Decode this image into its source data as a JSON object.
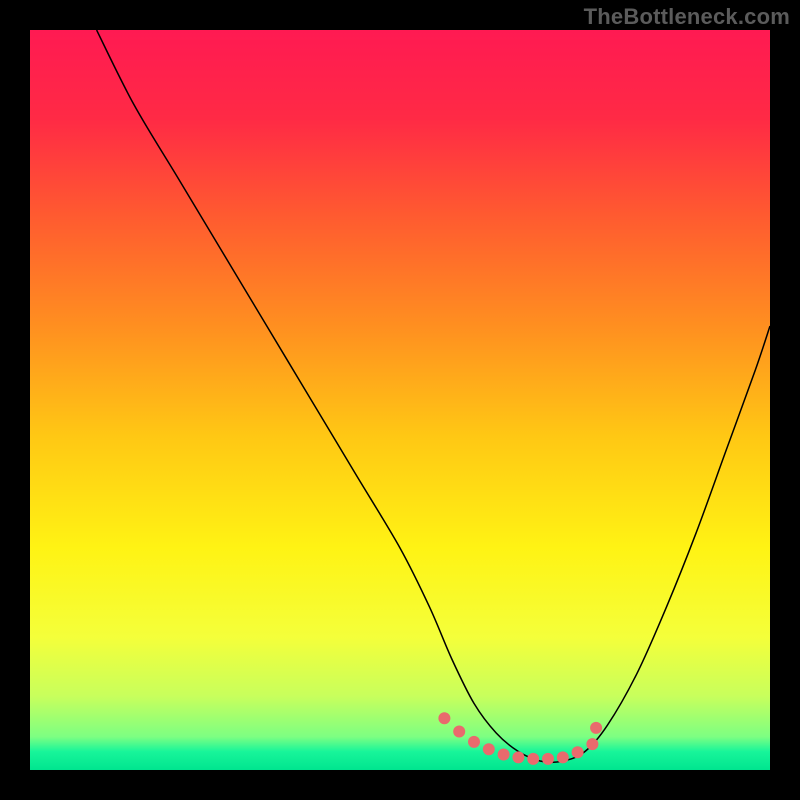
{
  "watermark": "TheBottleneck.com",
  "chart_data": {
    "type": "line",
    "title": "",
    "xlabel": "",
    "ylabel": "",
    "xlim": [
      0,
      100
    ],
    "ylim": [
      0,
      100
    ],
    "grid": false,
    "legend": false,
    "gradient_stops": [
      {
        "offset": 0.0,
        "color": "#ff1a52"
      },
      {
        "offset": 0.12,
        "color": "#ff2a45"
      },
      {
        "offset": 0.25,
        "color": "#ff5a30"
      },
      {
        "offset": 0.4,
        "color": "#ff8f20"
      },
      {
        "offset": 0.55,
        "color": "#ffc814"
      },
      {
        "offset": 0.7,
        "color": "#fff314"
      },
      {
        "offset": 0.82,
        "color": "#f4ff3a"
      },
      {
        "offset": 0.9,
        "color": "#c8ff5c"
      },
      {
        "offset": 0.955,
        "color": "#7dff82"
      },
      {
        "offset": 0.975,
        "color": "#18f59a"
      },
      {
        "offset": 1.0,
        "color": "#00e58f"
      }
    ],
    "series": [
      {
        "name": "bottleneck-curve",
        "color": "#000000",
        "stroke_width": 1.5,
        "x": [
          9,
          14,
          20,
          26,
          32,
          38,
          44,
          50,
          54,
          57,
          60,
          63,
          66,
          69,
          72,
          75,
          78,
          82,
          86,
          90,
          94,
          98,
          100
        ],
        "values": [
          100,
          90,
          80,
          70,
          60,
          50,
          40,
          30,
          22,
          15,
          9,
          5,
          2.5,
          1.2,
          1.2,
          2.5,
          6,
          13,
          22,
          32,
          43,
          54,
          60
        ]
      },
      {
        "name": "highlight-dots",
        "color": "#e96a6d",
        "marker_radius": 6,
        "x": [
          56,
          58,
          60,
          62,
          64,
          66,
          68,
          70,
          72,
          74,
          76,
          76.5
        ],
        "values": [
          7.0,
          5.2,
          3.8,
          2.8,
          2.1,
          1.7,
          1.5,
          1.5,
          1.7,
          2.4,
          3.5,
          5.7
        ]
      }
    ]
  }
}
